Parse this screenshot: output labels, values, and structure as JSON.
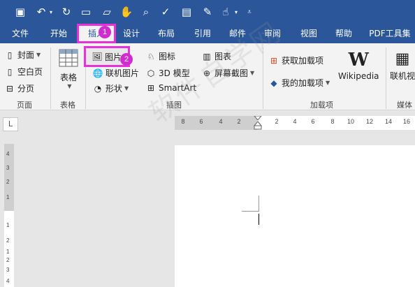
{
  "qat": {
    "icons": [
      "save-icon",
      "undo-icon",
      "redo-icon",
      "new-icon",
      "open-icon",
      "touch-mode-icon",
      "print-preview-icon",
      "spelling-icon",
      "save-as-pdf-icon",
      "edit-icon",
      "touch-icon",
      "customize-icon"
    ]
  },
  "tabs": [
    "文件",
    "开始",
    "插入",
    "设计",
    "布局",
    "引用",
    "邮件",
    "审阅",
    "视图",
    "帮助",
    "PDF工具集"
  ],
  "callouts": [
    "1",
    "2"
  ],
  "ribbon": {
    "pages": {
      "cover": "封面",
      "blank": "空白页",
      "break": "分页",
      "label": "页面"
    },
    "tables": {
      "table": "表格",
      "label": "表格"
    },
    "illustrations": {
      "picture": "图片",
      "online_picture": "联机图片",
      "shapes": "形状",
      "icons": "图标",
      "model3d": "3D 模型",
      "smartart": "SmartArt",
      "chart": "图表",
      "screenshot": "屏幕截图",
      "label": "插图"
    },
    "addins": {
      "get": "获取加载项",
      "my": "我的加载项",
      "wiki_logo": "W",
      "wiki": "Wikipedia",
      "label": "加载项"
    },
    "media": {
      "online_video": "联机视",
      "label": "媒体"
    }
  },
  "ruler": {
    "corner": "L",
    "h_ticks": [
      "8",
      "6",
      "4",
      "2",
      "2",
      "4",
      "6",
      "8",
      "10",
      "12",
      "14",
      "16"
    ],
    "v_ticks": [
      "4",
      "3",
      "2",
      "1",
      "1",
      "2",
      "1",
      "2",
      "3",
      "4"
    ]
  },
  "watermark": "软件自学网",
  "colors": {
    "titlebar": "#2b579a",
    "ribbon": "#f3f3f3",
    "callout": "#e632d8"
  }
}
